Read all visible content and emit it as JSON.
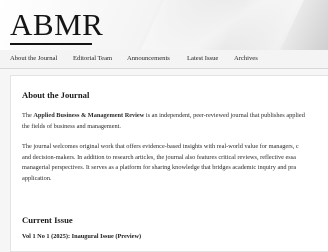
{
  "header": {
    "logo_text": "ABMR"
  },
  "nav": {
    "items": [
      {
        "label": "About the Journal"
      },
      {
        "label": "Editorial Team"
      },
      {
        "label": "Announcements"
      },
      {
        "label": "Latest Issue"
      },
      {
        "label": "Archives"
      }
    ]
  },
  "about": {
    "heading": "About the Journal",
    "p1_prefix": "The ",
    "p1_journal_name": "Applied Business & Management Review",
    "p1_rest_line1": " is an independent, peer-reviewed journal that publishes applied",
    "p1_line2": "the fields of business and management.",
    "p2_line1": "The journal welcomes original work that offers evidence-based insights with real-world value for managers, c",
    "p2_line2": "and decision-makers.  In addition to research articles, the journal also features critical reviews, reflective essa",
    "p2_line3": "managerial perspectives.  It serves as a platform for sharing knowledge that bridges academic inquiry and pra",
    "p2_line4": "application."
  },
  "current_issue": {
    "heading": "Current Issue",
    "issue_title": "Vol 1 No 1 (2025): Inaugural Issue (Preview)"
  }
}
